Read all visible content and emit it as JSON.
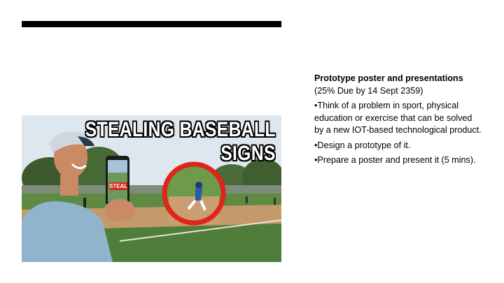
{
  "slide": {
    "image": {
      "headline_line1": "STEALING BASEBALL",
      "headline_line2": "SIGNS",
      "phone_label": "STEAL"
    },
    "text": {
      "title": "Prototype poster and presentations",
      "due": "(25% Due by 14 Sept 2359)",
      "bullet1": "•Think of a problem in sport, physical education or exercise that can be solved by a new IOT-based technological product.",
      "bullet2": "•Design a prototype of it.",
      "bullet3": "•Prepare a poster and present it (5 mins)."
    }
  },
  "colors": {
    "bar": "#000000",
    "circle": "#e02418",
    "grass": "#4f7d3a",
    "dirt": "#c49a6c",
    "sky": "#dfe7ee"
  }
}
